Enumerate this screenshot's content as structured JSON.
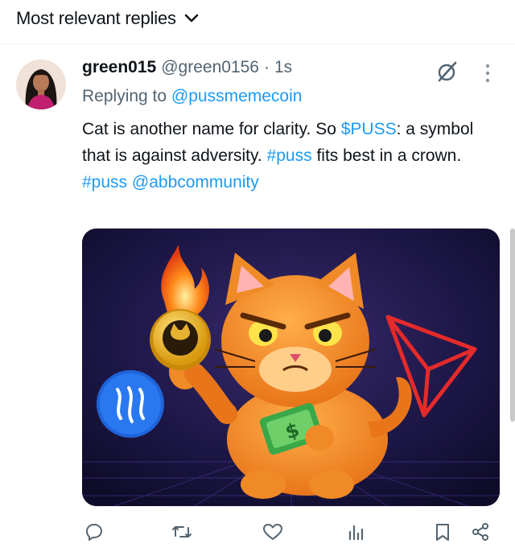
{
  "header": {
    "sort_label": "Most relevant replies",
    "sort_icon": "chevron-down-icon"
  },
  "reply": {
    "display_name": "green015",
    "handle": "@green0156",
    "separator": "·",
    "time": "1s",
    "replying_prefix": "Replying to",
    "replying_to": "@pussmemecoin",
    "text_part1": "Cat is another name for clarity. So ",
    "cashtag": "$PUSS",
    "text_part2": ": a symbol that is against adversity. ",
    "hashtag1": "#puss",
    "text_part3": " fits best in a crown.",
    "hashtag2": "#puss",
    "mention2": "@abbcommunity",
    "media_alt_icon": "cat-with-coin-image",
    "actions": [
      "reply-icon",
      "retweet-icon",
      "like-icon",
      "views-icon",
      "bookmark-icon",
      "share-icon"
    ]
  },
  "colors": {
    "link": "#1d9bf0",
    "secondary_text": "#536471",
    "primary_text": "#0f1419"
  }
}
